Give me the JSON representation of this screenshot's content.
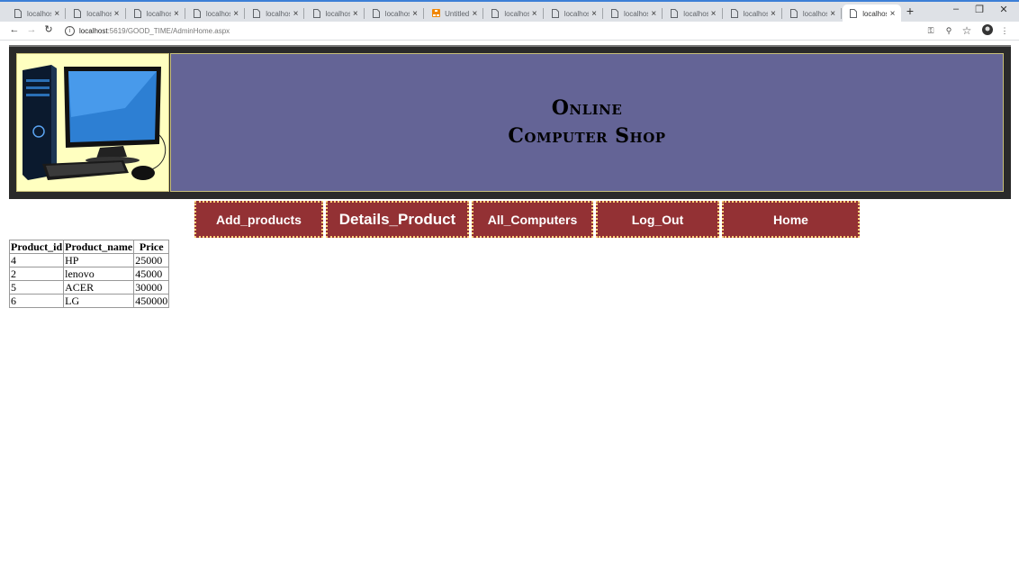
{
  "browser": {
    "tabs": [
      {
        "title": "localhost:",
        "icon": "page-icon"
      },
      {
        "title": "localhost:",
        "icon": "page-icon"
      },
      {
        "title": "localhost:",
        "icon": "page-icon"
      },
      {
        "title": "localhost:",
        "icon": "page-icon"
      },
      {
        "title": "localhost:",
        "icon": "page-icon"
      },
      {
        "title": "localhost:",
        "icon": "page-icon"
      },
      {
        "title": "localhost:",
        "icon": "page-icon"
      },
      {
        "title": "Untitled -",
        "icon": "drawio-icon"
      },
      {
        "title": "localhost:",
        "icon": "page-icon"
      },
      {
        "title": "localhost:",
        "icon": "page-icon"
      },
      {
        "title": "localhost:",
        "icon": "page-icon"
      },
      {
        "title": "localhost:",
        "icon": "page-icon"
      },
      {
        "title": "localhost:",
        "icon": "page-icon"
      },
      {
        "title": "localhost:",
        "icon": "page-icon"
      },
      {
        "title": "localhost:",
        "icon": "page-icon",
        "active": true
      }
    ],
    "url_host": "localhost",
    "url_path": ":5619/GOOD_TIME/AdminHome.aspx",
    "accent": "#3c7fd6"
  },
  "header": {
    "title_line1": "Online",
    "title_line2": "Computer Shop",
    "banner_color": "#646496",
    "logo_bg": "#ffffc0"
  },
  "nav": {
    "add_products": "Add_products",
    "details_product": "Details_Product",
    "all_computers": "All_Computers",
    "log_out": "Log_Out",
    "home": "Home",
    "button_color": "#933134"
  },
  "grid": {
    "columns": [
      "Product_id",
      "Product_name",
      "Price"
    ],
    "rows": [
      [
        "4",
        "HP",
        "25000"
      ],
      [
        "2",
        "lenovo",
        "45000"
      ],
      [
        "5",
        "ACER",
        "30000"
      ],
      [
        "6",
        "LG",
        "450000"
      ]
    ]
  }
}
